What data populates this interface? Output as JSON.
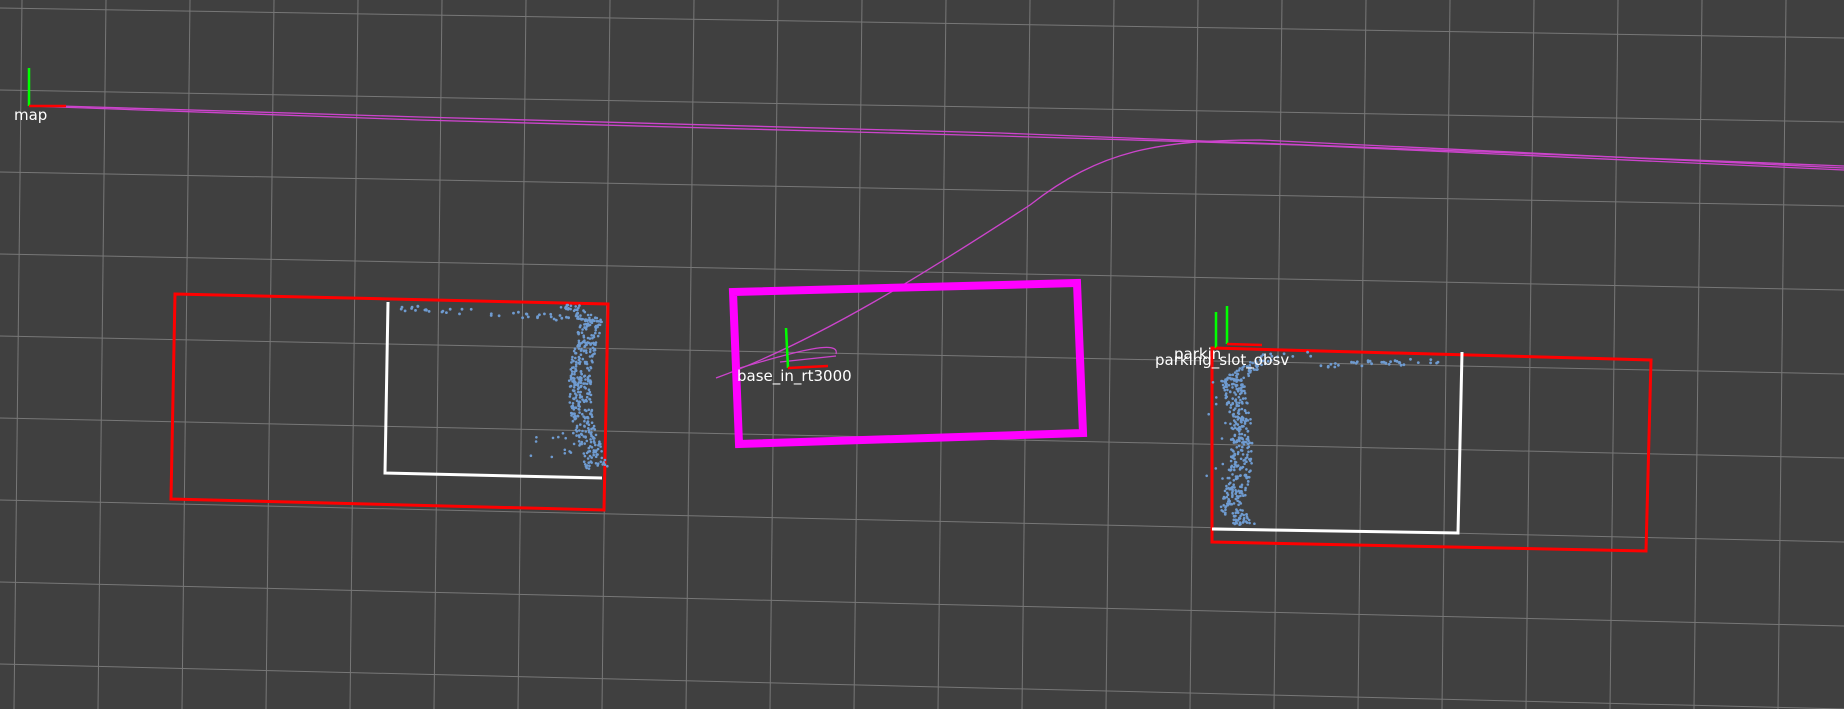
{
  "viewer": {
    "background_color": "#404040",
    "grid_color": "#8c8c8c",
    "frames": {
      "map": "map",
      "base": "base_in_rt3000",
      "parking_slot_front": "parkin",
      "parking_slot_back": "parking_slot_obsv"
    },
    "colors": {
      "x_axis": "#ff0000",
      "y_axis": "#00ff00",
      "trajectory": "#cc44cc",
      "vehicle_footprint": "#ff00ff",
      "parking_slot_outline": "#ff0000",
      "observed_slot_outline": "#ffffff",
      "point_cloud": "#6f9bd0"
    }
  }
}
